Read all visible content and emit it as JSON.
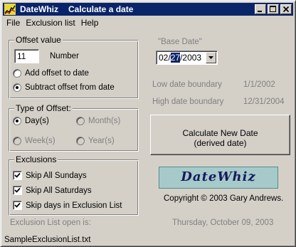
{
  "window": {
    "app_name": "DateWhiz",
    "title": "Calculate a date"
  },
  "menu": [
    "File",
    "Exclusion list",
    "Help"
  ],
  "offset_group": {
    "legend": "Offset value",
    "value": "11",
    "number_label": "Number",
    "add_label": "Add offset to date",
    "subtract_label": "Subtract offset from date",
    "selected": "subtract"
  },
  "type_group": {
    "legend": "Type of Offset:",
    "days_label": "Day(s)",
    "months_label": "Month(s)",
    "weeks_label": "Week(s)",
    "years_label": "Year(s)",
    "selected": "days"
  },
  "exclusions_group": {
    "legend": "Exclusions",
    "items": [
      {
        "label": "Skip All Sundays",
        "checked": true
      },
      {
        "label": "Skip All Saturdays",
        "checked": true
      },
      {
        "label": "Skip days in Exclusion List",
        "checked": true
      }
    ]
  },
  "exclusion_list_open_label": "Exclusion List open is:",
  "exclusion_file": "SampleExclusionList.txt",
  "base_date": {
    "label": "\"Base Date\"",
    "month": "02",
    "day": "27",
    "year": "2003",
    "sep": "/"
  },
  "low_boundary": {
    "label": "Low date boundary",
    "value": "1/1/2002"
  },
  "high_boundary": {
    "label": "High date boundary",
    "value": "12/31/2004"
  },
  "calc_button": {
    "line1": "Calculate New Date",
    "line2": "(derived date)"
  },
  "logo_text": "DateWhiz",
  "copyright": "Copyright © 2003 Gary Andrews.",
  "current_date": "Thursday, October 09, 2003"
}
